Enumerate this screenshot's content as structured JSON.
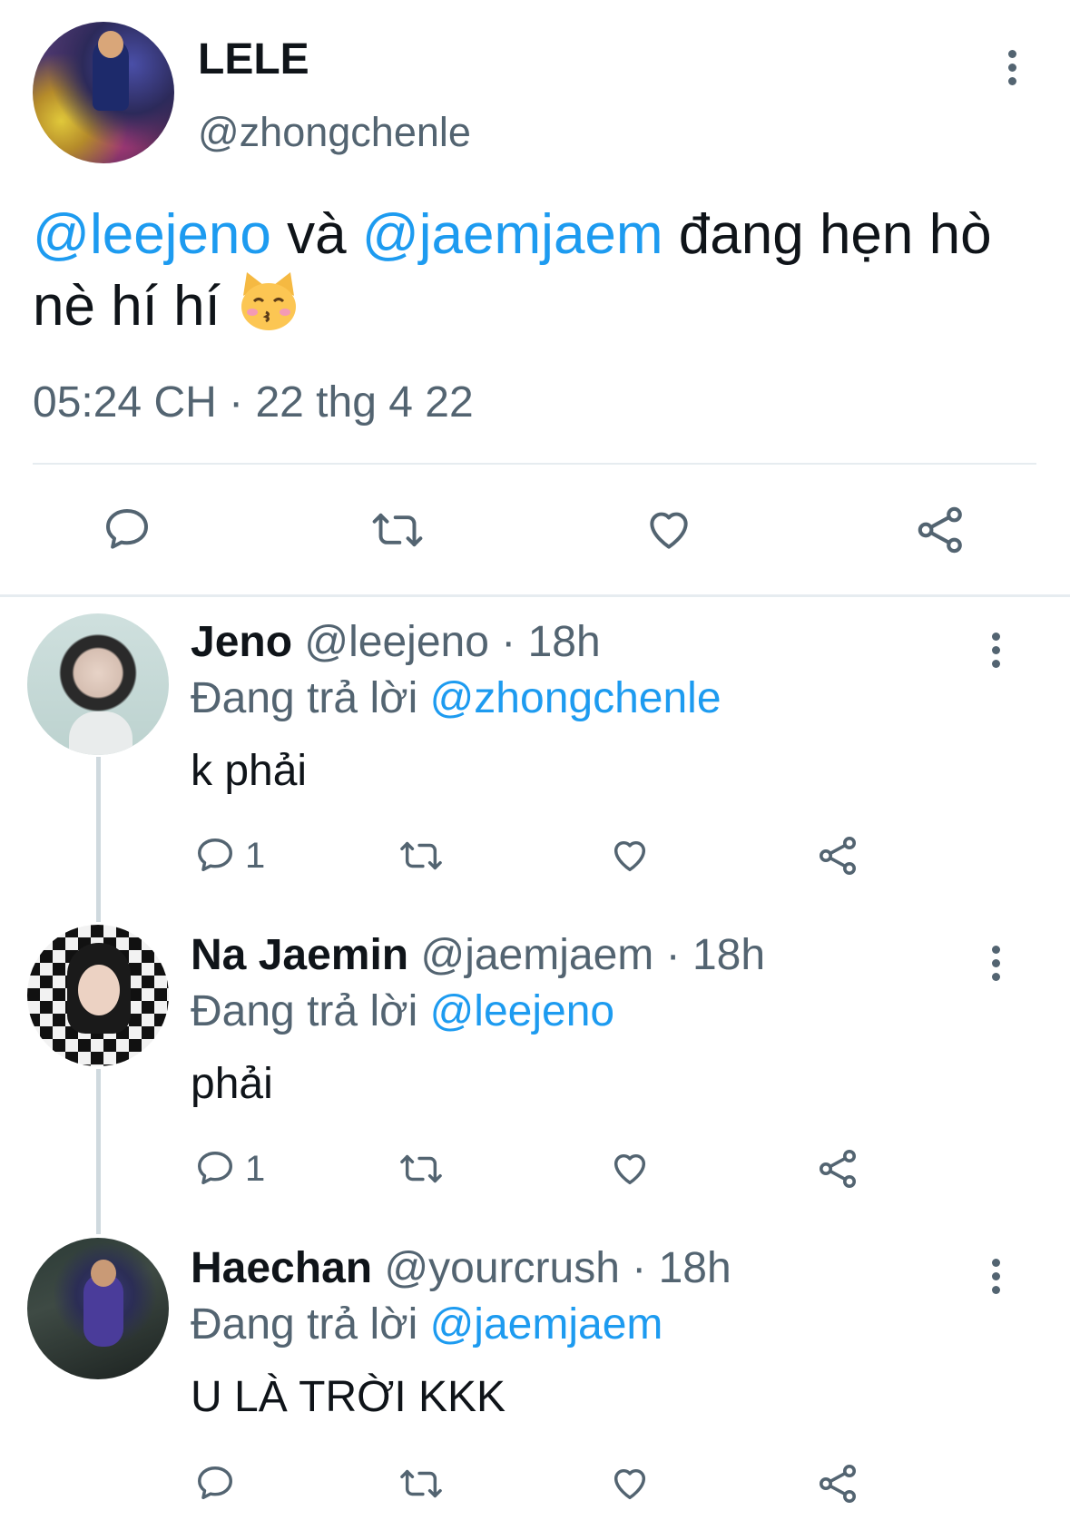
{
  "main_tweet": {
    "display_name": "LELE",
    "handle": "@zhongchenle",
    "text_parts": {
      "mention1": "@leejeno",
      "connector": " và ",
      "mention2": "@jaemjaem",
      "text": " đang hẹn hò nè hí hí "
    },
    "emoji_icon": "kissing-cat-emoji",
    "timestamp": "05:24 CH · 22 thg 4 22"
  },
  "replies": [
    {
      "display_name": "Jeno",
      "handle": "@leejeno",
      "sep": " · ",
      "time": "18h",
      "replying_label": "Đang trả lời ",
      "replying_to": "@zhongchenle",
      "text": "k phải",
      "reply_count": "1"
    },
    {
      "display_name": "Na Jaemin",
      "handle": "@jaemjaem",
      "sep": " · ",
      "time": "18h",
      "replying_label": "Đang trả lời ",
      "replying_to": "@leejeno",
      "text": "phải",
      "reply_count": "1"
    },
    {
      "display_name": "Haechan",
      "handle": "@yourcrush",
      "sep": " · ",
      "time": "18h",
      "replying_label": "Đang trả lời ",
      "replying_to": "@jaemjaem",
      "text": "U LÀ TRỜI KKK",
      "reply_count": ""
    }
  ],
  "icons": [
    "reply-icon",
    "retweet-icon",
    "like-icon",
    "share-icon",
    "more-options-icon"
  ],
  "colors": {
    "accent": "#1d9bf0",
    "secondary_text": "#536471",
    "divider": "#e6ecf0"
  }
}
